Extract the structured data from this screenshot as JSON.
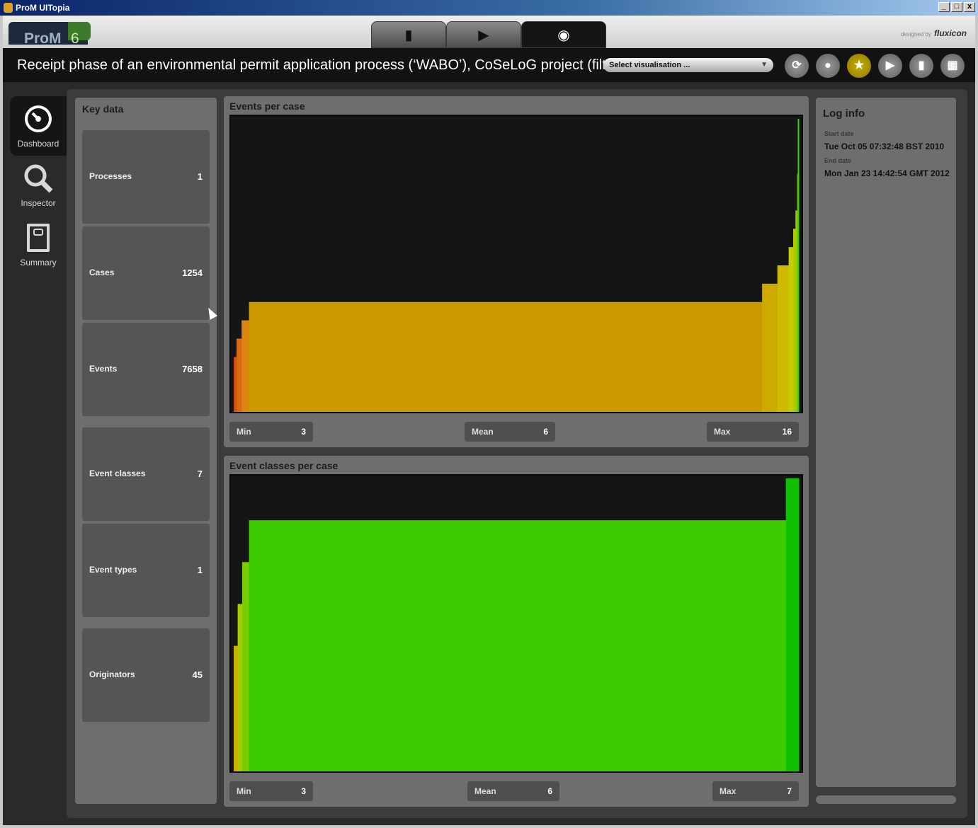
{
  "window": {
    "title": "ProM UITopia",
    "buttons": [
      "_",
      "□",
      "x"
    ]
  },
  "header": {
    "logo": "ProM",
    "logo_version": "6",
    "mode_tabs": [
      {
        "icon": "workspace-icon",
        "glyph": "▮"
      },
      {
        "icon": "play-icon",
        "glyph": "▶"
      },
      {
        "icon": "eye-icon",
        "glyph": "◉"
      }
    ],
    "designed_by": "designed by",
    "brand": "fluxicon"
  },
  "titlebar": {
    "log_title": "Receipt phase of an environmental permit application process (‘WABO’), CoSeLoG project (filt",
    "select_placeholder": "Select visualisation ...",
    "action_icons": [
      "refresh-icon",
      "drop-icon",
      "star-icon",
      "play-icon",
      "copy-icon",
      "grid-icon"
    ]
  },
  "sidebar": {
    "items": [
      {
        "label": "Dashboard",
        "icon": "dashboard-icon"
      },
      {
        "label": "Inspector",
        "icon": "magnifier-icon"
      },
      {
        "label": "Summary",
        "icon": "notebook-icon"
      }
    ]
  },
  "key_data": {
    "title": "Key data",
    "cards": [
      {
        "label": "Processes",
        "value": "1"
      },
      {
        "label": "Cases",
        "value": "1254"
      },
      {
        "label": "Events",
        "value": "7658"
      },
      {
        "label": "Event classes",
        "value": "7"
      },
      {
        "label": "Event types",
        "value": "1"
      },
      {
        "label": "Originators",
        "value": "45"
      }
    ]
  },
  "events_per_case": {
    "title": "Events per case",
    "stats": {
      "min_label": "Min",
      "min": "3",
      "mean_label": "Mean",
      "mean": "6",
      "max_label": "Max",
      "max": "16"
    }
  },
  "event_classes_per_case": {
    "title": "Event classes per case",
    "stats": {
      "min_label": "Min",
      "min": "3",
      "mean_label": "Mean",
      "mean": "6",
      "max_label": "Max",
      "max": "7"
    }
  },
  "log_info": {
    "title": "Log info",
    "start_label": "Start date",
    "start_date": "Tue Oct 05 07:32:48 BST 2010",
    "end_label": "End date",
    "end_date": "Mon Jan 23 14:42:54 GMT 2012"
  },
  "chart_data": [
    {
      "type": "area",
      "title": "Events per case",
      "x_label": "",
      "y_label": "",
      "ylim": [
        0,
        16
      ],
      "steps": [
        {
          "x_from": 0,
          "x_to": 0.005,
          "y": 3,
          "color": "#d05010"
        },
        {
          "x_from": 0.005,
          "x_to": 0.014,
          "y": 4,
          "color": "#d86a10"
        },
        {
          "x_from": 0.014,
          "x_to": 0.027,
          "y": 5,
          "color": "#dc8410"
        },
        {
          "x_from": 0.027,
          "x_to": 0.935,
          "y": 6,
          "color": "#cc9900"
        },
        {
          "x_from": 0.935,
          "x_to": 0.962,
          "y": 7,
          "color": "#ccaa00"
        },
        {
          "x_from": 0.962,
          "x_to": 0.982,
          "y": 8,
          "color": "#ccbb00"
        },
        {
          "x_from": 0.982,
          "x_to": 0.99,
          "y": 9,
          "color": "#c6cc00"
        },
        {
          "x_from": 0.99,
          "x_to": 0.994,
          "y": 10,
          "color": "#b0cc00"
        },
        {
          "x_from": 0.994,
          "x_to": 0.997,
          "y": 11,
          "color": "#98cc00"
        },
        {
          "x_from": 0.997,
          "x_to": 0.998,
          "y": 13,
          "color": "#70cc00"
        },
        {
          "x_from": 0.998,
          "x_to": 1.0,
          "y": 16,
          "color": "#3ccc00"
        }
      ]
    },
    {
      "type": "area",
      "title": "Event classes per case",
      "x_label": "",
      "y_label": "",
      "ylim": [
        0,
        7
      ],
      "steps": [
        {
          "x_from": 0,
          "x_to": 0.007,
          "y": 3,
          "color": "#ccb000"
        },
        {
          "x_from": 0.007,
          "x_to": 0.015,
          "y": 4,
          "color": "#a6cc00"
        },
        {
          "x_from": 0.015,
          "x_to": 0.027,
          "y": 5,
          "color": "#78cc00"
        },
        {
          "x_from": 0.027,
          "x_to": 0.977,
          "y": 6,
          "color": "#3ccc00"
        },
        {
          "x_from": 0.977,
          "x_to": 1.0,
          "y": 7,
          "color": "#10c000"
        }
      ]
    }
  ]
}
